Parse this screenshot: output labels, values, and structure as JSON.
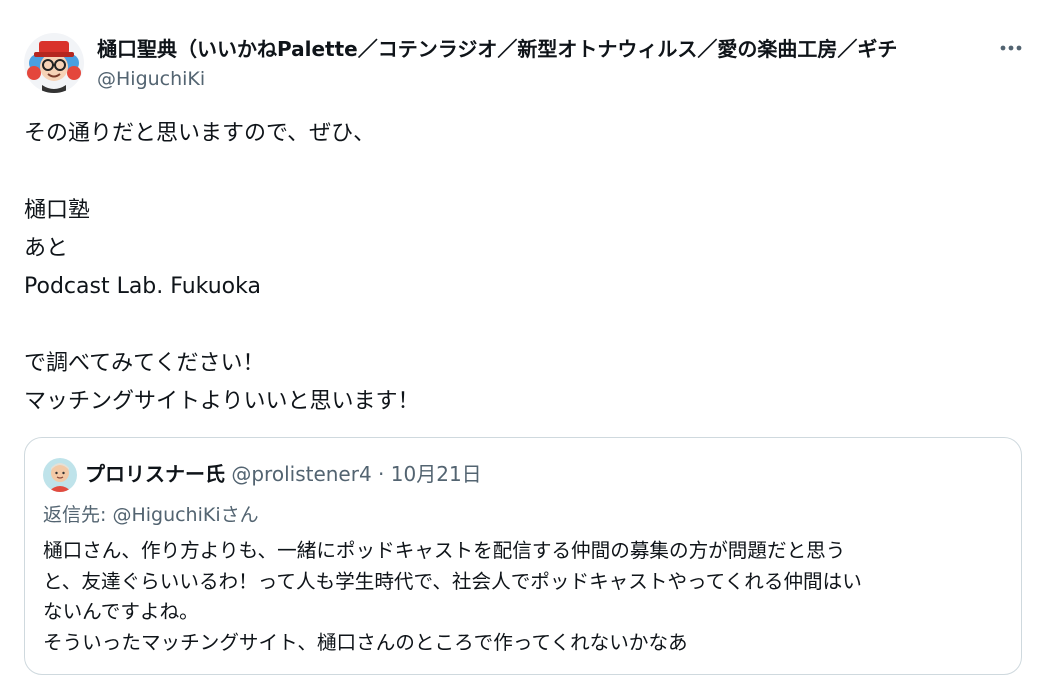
{
  "tweet": {
    "author_name": "樋口聖典（いいかねPalette／コテンラジオ／新型オトナウィルス／愛の楽曲工房／ギチ",
    "author_handle": "@HiguchiKi",
    "more_icon": "ellipsis-icon",
    "text_lines": [
      "その通りだと思いますので、ぜひ、",
      "",
      "樋口塾",
      "あと",
      "Podcast Lab. Fukuoka",
      "",
      "で調べてみてください！",
      "マッチングサイトよりいいと思います！"
    ]
  },
  "quote": {
    "author_name": "プロリスナー氏",
    "author_handle": "@prolistener4",
    "separator": " · ",
    "date": "10月21日",
    "reply_to": "返信先: @HiguchiKiさん",
    "text_lines": [
      "樋口さん、作り方よりも、一緒にポッドキャストを配信する仲間の募集の方が問題だと思う",
      "と、友達ぐらいいるわ！って人も学生時代で、社会人でポッドキャストやってくれる仲間はい",
      "ないんですよね。",
      "そういったマッチングサイト、樋口さんのところで作ってくれないかなあ"
    ]
  },
  "colors": {
    "text_primary": "#0f1419",
    "text_secondary": "#536471",
    "border": "#cfd9de"
  }
}
